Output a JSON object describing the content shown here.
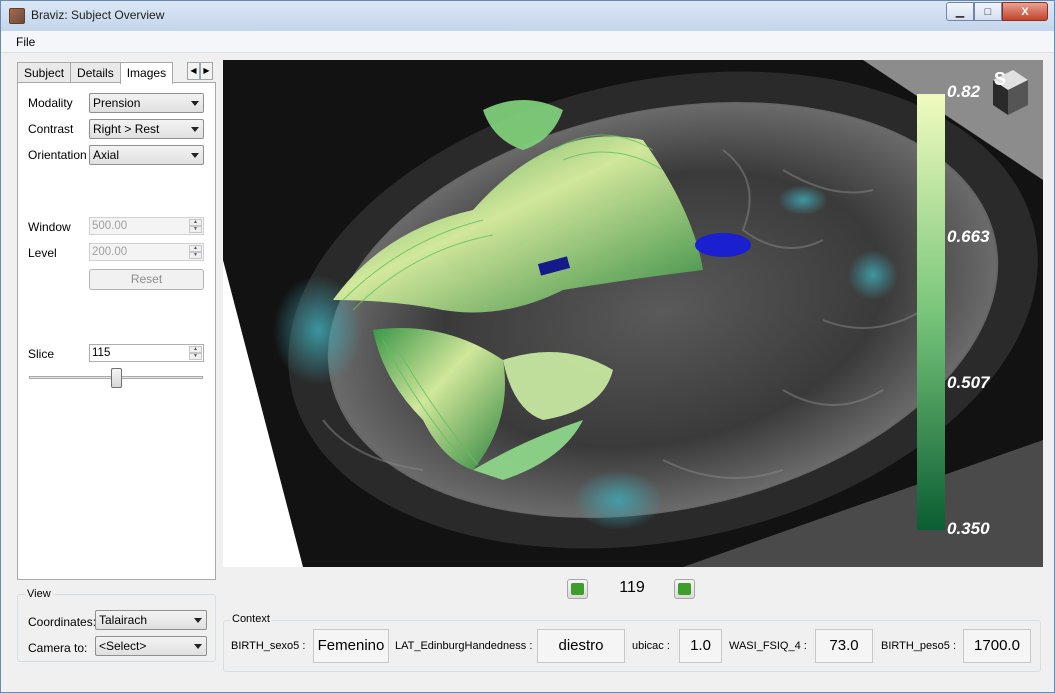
{
  "window": {
    "title": "Braviz: Subject Overview",
    "minimize": "▁",
    "maximize": "□",
    "close": "X"
  },
  "menu": {
    "file": "File"
  },
  "tabs": [
    {
      "label": "Subject"
    },
    {
      "label": "Details"
    },
    {
      "label": "Images"
    }
  ],
  "tab_scroll": {
    "left": "◀",
    "right": "▶"
  },
  "images_panel": {
    "modality_label": "Modality",
    "modality_value": "Prension",
    "contrast_label": "Contrast",
    "contrast_value": "Right > Rest",
    "orientation_label": "Orientation",
    "orientation_value": "Axial",
    "window_label": "Window",
    "window_value": "500.00",
    "level_label": "Level",
    "level_value": "200.00",
    "reset_label": "Reset",
    "slice_label": "Slice",
    "slice_value": "115",
    "slice_slider_fraction": 0.5
  },
  "view_group": {
    "title": "View",
    "coordinates_label": "Coordinates:",
    "coordinates_value": "Talairach",
    "camera_label": "Camera to:",
    "camera_value": "<Select>"
  },
  "viewer": {
    "orientation_cube_letter": "S",
    "colorbar_ticks": [
      "0.82",
      "0.663",
      "0.507",
      "0.350"
    ],
    "colorbar_colors": {
      "top": "#f1fbbf",
      "mid": "#78c67a",
      "bottom": "#0b5d33"
    },
    "fiber_color": "#8fd98a",
    "roi_color": "#1a1fd0",
    "activation_color": "#3fa8b4"
  },
  "navigation": {
    "slice_number": "119"
  },
  "context": {
    "title": "Context",
    "items": [
      {
        "label": "BIRTH_sexo5 :",
        "value": "Femenino"
      },
      {
        "label": "LAT_EdinburgHandedness :",
        "value": "diestro"
      },
      {
        "label": "ubicac :",
        "value": "1.0"
      },
      {
        "label": "WASI_FSIQ_4 :",
        "value": "73.0"
      },
      {
        "label": "BIRTH_peso5 :",
        "value": "1700.0"
      }
    ]
  }
}
